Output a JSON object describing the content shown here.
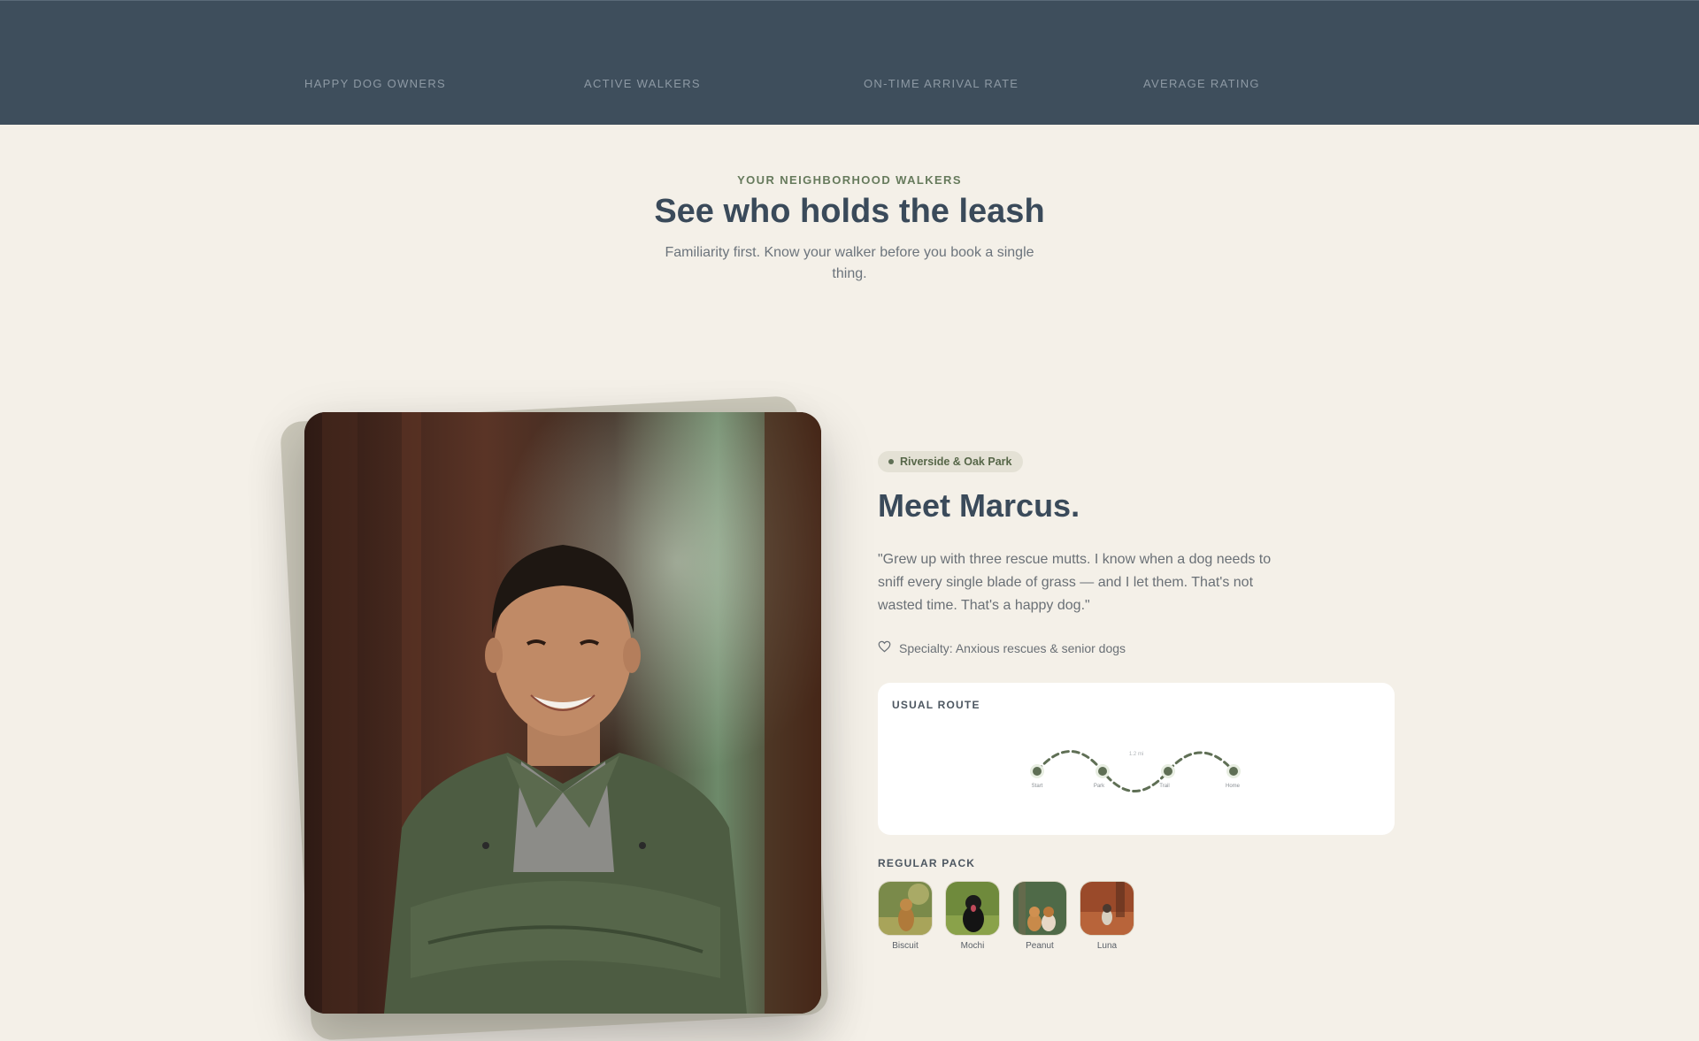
{
  "stats": [
    {
      "label": "HAPPY DOG OWNERS"
    },
    {
      "label": "ACTIVE WALKERS"
    },
    {
      "label": "ON-TIME ARRIVAL RATE"
    },
    {
      "label": "AVERAGE RATING"
    }
  ],
  "intro": {
    "eyebrow": "YOUR NEIGHBORHOOD WALKERS",
    "headline": "See who holds the leash",
    "subhead": "Familiarity first. Know your walker before you book a single thing."
  },
  "walker": {
    "location": "Riverside & Oak Park",
    "name": "Meet Marcus.",
    "quote": "\"Grew up with three rescue mutts. I know when a dog needs to sniff every single blade of grass — and I let them. That's not wasted time. That's a happy dog.\"",
    "specialty": "Specialty: Anxious rescues & senior dogs",
    "specialty_icon": "heart-icon"
  },
  "route": {
    "title": "USUAL ROUTE",
    "stops": [
      "Start",
      "Park",
      "Trail",
      "Home"
    ],
    "midpoint_label": "1.2 mi",
    "color": "#5f6f55"
  },
  "pack": {
    "title": "REGULAR PACK",
    "dogs": [
      {
        "name": "Biscuit"
      },
      {
        "name": "Mochi"
      },
      {
        "name": "Peanut"
      },
      {
        "name": "Luna"
      }
    ]
  },
  "colors": {
    "header_bg": "#3e4e5c",
    "page_bg": "#f4f0e8",
    "accent_green": "#5f6f55"
  }
}
